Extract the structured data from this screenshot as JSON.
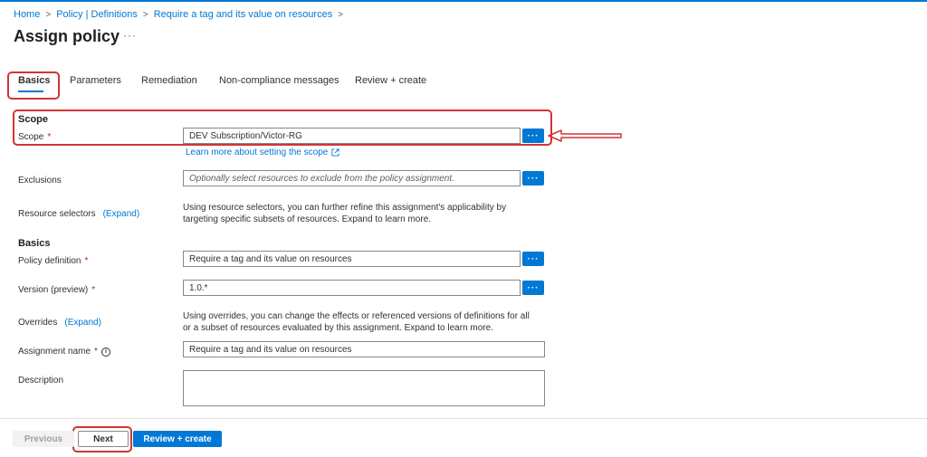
{
  "breadcrumb": {
    "items": [
      "Home",
      "Policy | Definitions",
      "Require a tag and its value on resources"
    ],
    "separator": ">"
  },
  "page": {
    "title": "Assign policy",
    "more_label": "···"
  },
  "tabs": [
    {
      "label": "Basics",
      "active": true
    },
    {
      "label": "Parameters",
      "active": false
    },
    {
      "label": "Remediation",
      "active": false
    },
    {
      "label": "Non-compliance messages",
      "active": false
    },
    {
      "label": "Review + create",
      "active": false
    }
  ],
  "scope_section": {
    "title": "Scope",
    "scope_label": "Scope",
    "required_mark": "*",
    "scope_value": "DEV Subscription/Victor-RG",
    "learn_more": "Learn more about setting the scope"
  },
  "exclusions": {
    "label": "Exclusions",
    "placeholder": "Optionally select resources to exclude from the policy assignment."
  },
  "resource_selectors": {
    "label": "Resource selectors",
    "expand": "(Expand)",
    "help": "Using resource selectors, you can further refine this assignment's applicability by targeting specific subsets of resources. Expand to learn more."
  },
  "basics_section": {
    "title": "Basics",
    "policy_definition_label": "Policy definition",
    "policy_definition_value": "Require a tag and its value on resources",
    "version_label": "Version (preview)",
    "version_value": "1.0.*",
    "overrides_label": "Overrides",
    "overrides_expand": "(Expand)",
    "overrides_help": "Using overrides, you can change the effects or referenced versions of definitions for all or a subset of resources evaluated by this assignment. Expand to learn more.",
    "assignment_name_label": "Assignment name",
    "assignment_name_value": "Require a tag and its value on resources",
    "description_label": "Description",
    "info_glyph": "i"
  },
  "browse_button_label": "···",
  "footer": {
    "previous": "Previous",
    "next": "Next",
    "review_create": "Review + create"
  },
  "colors": {
    "accent": "#0078d4",
    "annotation_red": "#d13438",
    "required": "#a4262c"
  },
  "icons": {
    "external_link": "external-link-icon",
    "info": "info-icon",
    "annotation_arrow": "arrow-left-icon"
  }
}
